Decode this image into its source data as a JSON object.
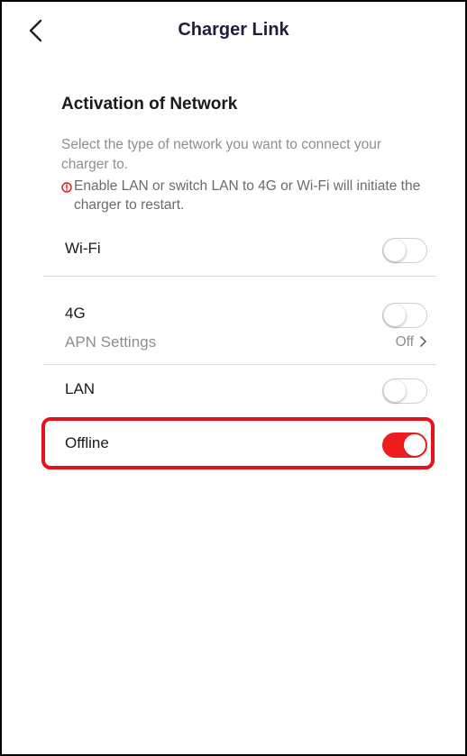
{
  "header": {
    "title": "Charger Link",
    "back_icon": "chevron-left-icon"
  },
  "section": {
    "title": "Activation of Network",
    "description": "Select the type of network you want to connect your charger to.",
    "warning": "Enable LAN or switch LAN to 4G or Wi-Fi will initiate the charger to restart.",
    "warning_icon": "alert-circle-icon",
    "warning_color": "#e8101a"
  },
  "options": {
    "wifi": {
      "label": "Wi-Fi",
      "enabled": false
    },
    "fourg": {
      "label": "4G",
      "enabled": false
    },
    "apn": {
      "label": "APN Settings",
      "value": "Off"
    },
    "lan": {
      "label": "LAN",
      "enabled": false
    },
    "offline": {
      "label": "Offline",
      "enabled": true
    }
  },
  "colors": {
    "accent": "#ef1d1d",
    "highlight": "#e8101a",
    "title": "#1f1f3d"
  }
}
